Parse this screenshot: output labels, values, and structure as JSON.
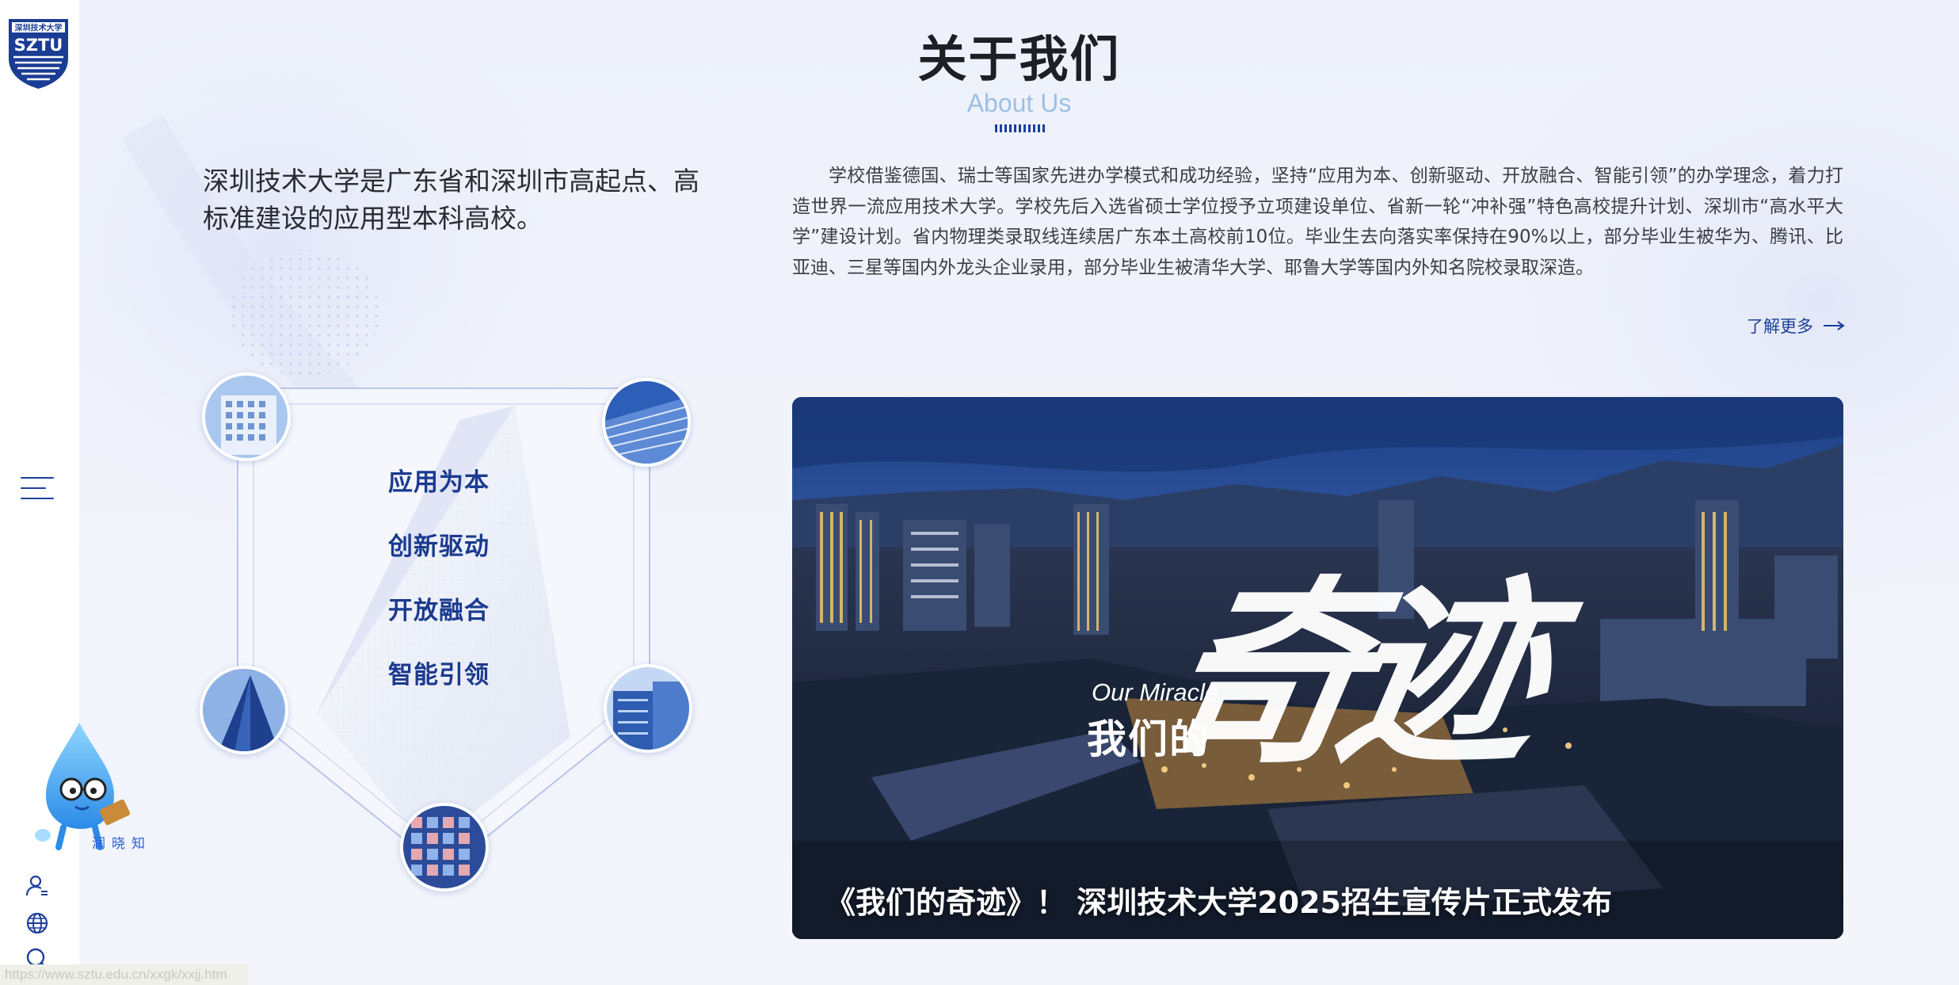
{
  "logo": {
    "top_text": "深圳技术大学",
    "abbr": "SZTU"
  },
  "header": {
    "title": "关于我们",
    "subtitle": "About Us"
  },
  "intro": {
    "lead": "深圳技术大学是广东省和深圳市高起点、高标准建设的应用型本科高校。",
    "body": "学校借鉴德国、瑞士等国家先进办学模式和成功经验，坚持“应用为本、创新驱动、开放融合、智能引领”的办学理念，着力打造世界一流应用技术大学。学校先后入选省硕士学位授予立项建设单位、省新一轮“冲补强”特色高校提升计划、深圳市“高水平大学”建设计划。省内物理类录取线连续居广东本土高校前10位。毕业生去向落实率保持在90%以上，部分毕业生被华为、腾讯、比亚迪、三星等国内外龙头企业录用，部分毕业生被清华大学、耶鲁大学等国内外知名院校录取深造。",
    "learn_more": "了解更多"
  },
  "motto": {
    "items": [
      "应用为本",
      "创新驱动",
      "开放融合",
      "智能引领"
    ]
  },
  "video": {
    "overlay_en": "Our Miracle",
    "overlay_cn": "我们的",
    "overlay_big": "奇迹",
    "caption": "《我们的奇迹》！ 深圳技术大学2025招生宣传片正式发布"
  },
  "mascot": {
    "label": "润晓知"
  },
  "sidebar": {
    "icons": [
      "user-icon",
      "globe-icon",
      "search-icon"
    ]
  },
  "status_bar": {
    "url": "https://www.sztu.edu.cn/xxgk/xxjj.htm"
  },
  "colors": {
    "brand_blue": "#1b3a8f",
    "accent_light_blue": "#9bc0e4",
    "text_dark": "#1d1f24"
  }
}
